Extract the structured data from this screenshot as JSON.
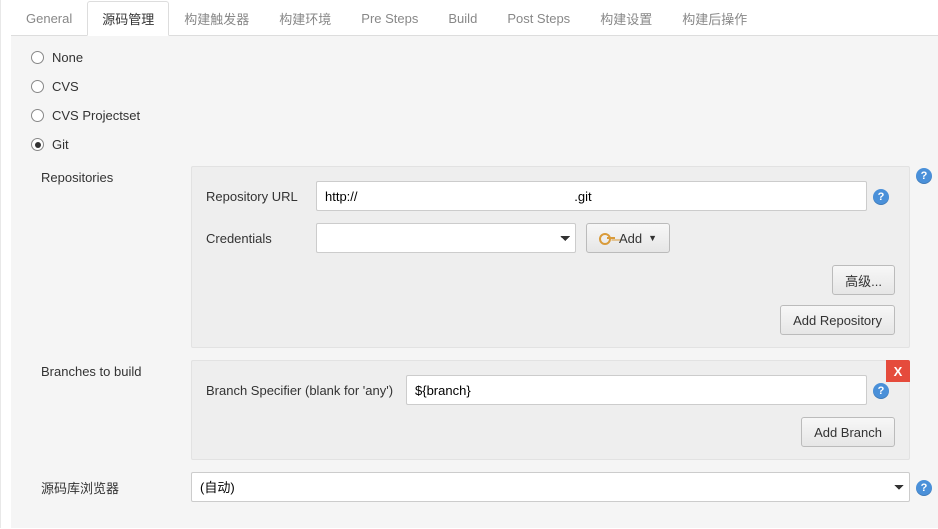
{
  "tabs": [
    {
      "label": "General",
      "active": false
    },
    {
      "label": "源码管理",
      "active": true
    },
    {
      "label": "构建触发器",
      "active": false
    },
    {
      "label": "构建环境",
      "active": false
    },
    {
      "label": "Pre Steps",
      "active": false
    },
    {
      "label": "Build",
      "active": false
    },
    {
      "label": "Post Steps",
      "active": false
    },
    {
      "label": "构建设置",
      "active": false
    },
    {
      "label": "构建后操作",
      "active": false
    }
  ],
  "scm_options": {
    "none": "None",
    "cvs": "CVS",
    "cvs_projectset": "CVS Projectset",
    "git": "Git",
    "selected": "git"
  },
  "labels": {
    "repositories": "Repositories",
    "repository_url": "Repository URL",
    "credentials": "Credentials",
    "advanced": "高级...",
    "add_repository": "Add Repository",
    "branches_to_build": "Branches to build",
    "branch_specifier": "Branch Specifier (blank for 'any')",
    "add_branch": "Add Branch",
    "repo_browser": "源码库浏览器",
    "add_button": "Add",
    "delete": "X"
  },
  "values": {
    "repository_url": "http://                                                            .git",
    "selected_credential": "",
    "branch_specifier": "${branch}",
    "repo_browser_selected": "(自动)"
  }
}
